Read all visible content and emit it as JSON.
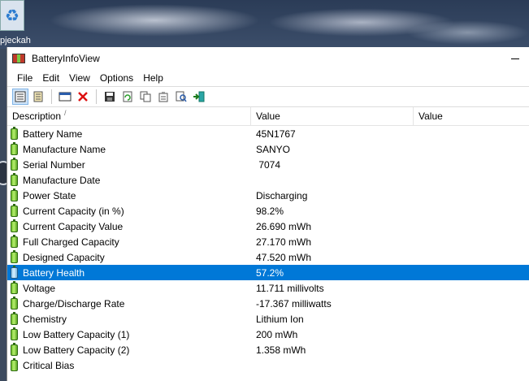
{
  "desktop": {
    "label": "pjeckah"
  },
  "window": {
    "title": "BatteryInfoView",
    "menu": [
      "File",
      "Edit",
      "View",
      "Options",
      "Help"
    ],
    "toolbar": [
      "view-list-icon",
      "view-props-icon",
      "html-report-icon",
      "delete-icon",
      "save-icon",
      "refresh-icon",
      "copy-icon",
      "properties-icon",
      "find-icon",
      "exit-icon"
    ],
    "columns": [
      "Description",
      "Value",
      "Value"
    ],
    "sort_indicator": "/",
    "rows": [
      {
        "desc": "Battery Name",
        "value": "45N1767"
      },
      {
        "desc": "Manufacture Name",
        "value": "SANYO"
      },
      {
        "desc": "Serial Number",
        "value": " 7074"
      },
      {
        "desc": "Manufacture Date",
        "value": ""
      },
      {
        "desc": "Power State",
        "value": "Discharging"
      },
      {
        "desc": "Current Capacity (in %)",
        "value": "98.2%"
      },
      {
        "desc": "Current Capacity Value",
        "value": "26.690 mWh"
      },
      {
        "desc": "Full Charged Capacity",
        "value": "27.170 mWh"
      },
      {
        "desc": "Designed Capacity",
        "value": "47.520 mWh"
      },
      {
        "desc": "Battery Health",
        "value": "57.2%"
      },
      {
        "desc": "Voltage",
        "value": "11.711 millivolts"
      },
      {
        "desc": "Charge/Discharge Rate",
        "value": "-17.367 milliwatts"
      },
      {
        "desc": "Chemistry",
        "value": "Lithium Ion"
      },
      {
        "desc": "Low Battery Capacity (1)",
        "value": "200 mWh"
      },
      {
        "desc": "Low Battery Capacity (2)",
        "value": "1.358 mWh"
      },
      {
        "desc": "Critical Bias",
        "value": ""
      }
    ],
    "selected_row": 9,
    "colors": {
      "selection": "#0078d7",
      "battery_green": "#6fbf2c"
    }
  }
}
